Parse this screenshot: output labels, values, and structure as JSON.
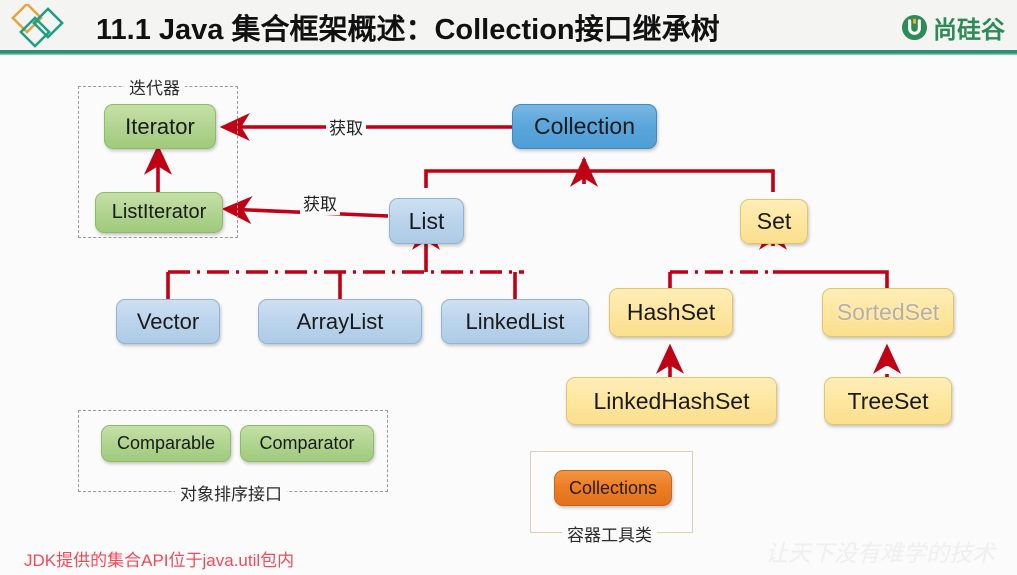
{
  "header": {
    "title": "11.1 Java 集合框架概述：Collection接口继承树",
    "brand_text": "尚硅谷",
    "brand_icon": "circle-u-logo-icon",
    "logo_icon": "three-diamonds-logo-icon",
    "rule_color": "#2e8b74"
  },
  "diagram": {
    "title": "Collection interface inheritance tree",
    "groups": [
      {
        "id": "iterator-group",
        "label": "迭代器",
        "style": "dashed"
      },
      {
        "id": "sorting-group",
        "label": "对象排序接口",
        "style": "dashed"
      },
      {
        "id": "tools-group",
        "label": "容器工具类",
        "style": "solid"
      }
    ],
    "nodes": [
      {
        "id": "iterator",
        "label": "Iterator",
        "color": "#b3d693",
        "kind": "green"
      },
      {
        "id": "list-iterator",
        "label": "ListIterator",
        "color": "#b3d693",
        "kind": "green"
      },
      {
        "id": "collection",
        "label": "Collection",
        "color": "#5ca7dc",
        "kind": "blue-dark"
      },
      {
        "id": "list",
        "label": "List",
        "color": "#bcd5ec",
        "kind": "blue-light"
      },
      {
        "id": "vector",
        "label": "Vector",
        "color": "#bcd5ec",
        "kind": "blue-light"
      },
      {
        "id": "arraylist",
        "label": "ArrayList",
        "color": "#bcd5ec",
        "kind": "blue-light"
      },
      {
        "id": "linkedlist",
        "label": "LinkedList",
        "color": "#bcd5ec",
        "kind": "blue-light"
      },
      {
        "id": "set",
        "label": "Set",
        "color": "#fde7a2",
        "kind": "yellow"
      },
      {
        "id": "hashset",
        "label": "HashSet",
        "color": "#fde7a2",
        "kind": "yellow"
      },
      {
        "id": "sortedset",
        "label": "SortedSet",
        "color": "#fde7a2",
        "kind": "yellow",
        "faded": true
      },
      {
        "id": "linkedhashset",
        "label": "LinkedHashSet",
        "color": "#fde7a2",
        "kind": "yellow"
      },
      {
        "id": "treeset",
        "label": "TreeSet",
        "color": "#fde7a2",
        "kind": "yellow"
      },
      {
        "id": "comparable",
        "label": "Comparable",
        "color": "#b3d693",
        "kind": "green"
      },
      {
        "id": "comparator",
        "label": "Comparator",
        "color": "#b3d693",
        "kind": "green"
      },
      {
        "id": "collections",
        "label": "Collections",
        "color": "#ec7f26",
        "kind": "orange"
      }
    ],
    "edge_labels": [
      {
        "id": "collection-to-iterator",
        "label": "获取"
      },
      {
        "id": "list-to-listiterator",
        "label": "获取"
      }
    ],
    "edge_color": "#c00014"
  },
  "footer": {
    "note": "JDK提供的集合API位于java.util包内",
    "note_color": "#f04b5a",
    "watermark": "让天下没有难学的技术"
  }
}
